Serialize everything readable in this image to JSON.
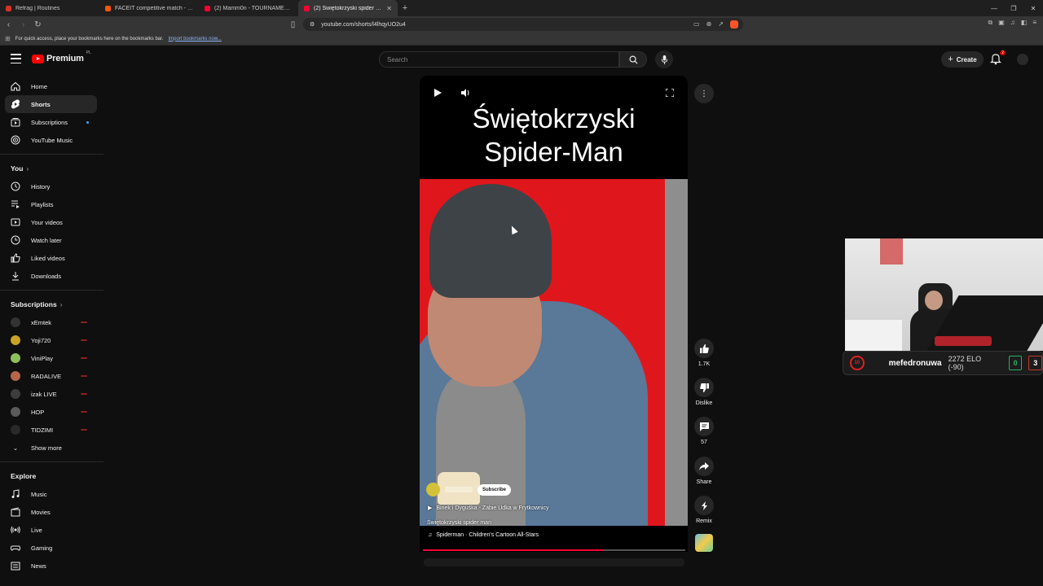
{
  "browser": {
    "tabs": [
      {
        "label": "Refrag | Routines",
        "color": "#d93025",
        "active": false
      },
      {
        "label": "FACEIT competitive match - FACEIT.c",
        "color": "#ff5500",
        "active": false
      },
      {
        "label": "(2) Mamm0n - TOURNAMENT CD | E",
        "color": "#ff0033",
        "active": false
      },
      {
        "label": "(2) Świętokrzyski spider man",
        "color": "#ff0033",
        "active": true
      }
    ],
    "url": "youtube.com/shorts/l4lhqyUO2u4",
    "bookmarks_text": "For quick access, place your bookmarks here on the bookmarks bar.",
    "bookmarks_link": "Import bookmarks now..."
  },
  "header": {
    "logo_text": "Premium",
    "logo_region": "PL",
    "search_placeholder": "Search",
    "create_label": "Create",
    "notif_count": "2"
  },
  "sidebar": {
    "main": [
      {
        "label": "Home",
        "icon": "home-icon"
      },
      {
        "label": "Shorts",
        "icon": "shorts-icon",
        "active": true
      },
      {
        "label": "Subscriptions",
        "icon": "subscriptions-icon"
      },
      {
        "label": "YouTube Music",
        "icon": "youtube-music-icon"
      }
    ],
    "you_title": "You",
    "you_items": [
      {
        "label": "History",
        "icon": "history-icon"
      },
      {
        "label": "Playlists",
        "icon": "playlists-icon"
      },
      {
        "label": "Your videos",
        "icon": "your-videos-icon"
      },
      {
        "label": "Watch later",
        "icon": "watch-later-icon"
      },
      {
        "label": "Liked videos",
        "icon": "liked-videos-icon"
      },
      {
        "label": "Downloads",
        "icon": "downloads-icon"
      }
    ],
    "subs_title": "Subscriptions",
    "channels": [
      {
        "label": "xEmtek",
        "color": "#333333"
      },
      {
        "label": "Yoji720",
        "color": "#c9a227"
      },
      {
        "label": "ViniPlay",
        "color": "#8fbf5a"
      },
      {
        "label": "RADALIVE",
        "color": "#b5654a"
      },
      {
        "label": "izak LIVE",
        "color": "#3d3d3d"
      },
      {
        "label": "HOP",
        "color": "#5a5a5a"
      },
      {
        "label": "TIDZIMI",
        "color": "#2a2a2a"
      }
    ],
    "show_more": "Show more",
    "explore_title": "Explore",
    "explore_items": [
      {
        "label": "Music",
        "icon": "music-icon"
      },
      {
        "label": "Movies",
        "icon": "movies-icon"
      },
      {
        "label": "Live",
        "icon": "live-icon"
      },
      {
        "label": "Gaming",
        "icon": "gaming-icon"
      },
      {
        "label": "News",
        "icon": "news-icon"
      }
    ]
  },
  "short": {
    "title_line1": "Świętokrzyski",
    "title_line2": "Spider-Man",
    "subscribe_label": "Subscribe",
    "playlist": "Binek i Dyguśka - Żabie Udka w Frytkownicy",
    "video_title": "Świętokrzyski spider man",
    "music": "Spiderman · Children's Cartoon All-Stars",
    "progress": 0.69
  },
  "actions": {
    "likes": "1.7K",
    "dislike": "Dislike",
    "comments": "57",
    "share": "Share",
    "remix": "Remix"
  },
  "faceit": {
    "level": "10",
    "nick": "mefedronuwa",
    "elo": "2272 ELO (-90)",
    "wins": "0",
    "losses": "3"
  }
}
